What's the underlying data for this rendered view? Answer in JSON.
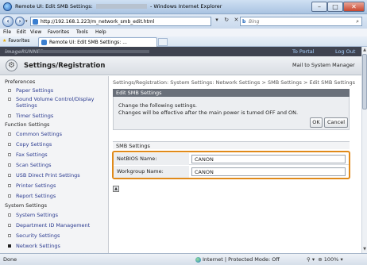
{
  "window": {
    "title_prefix": "Remote UI: Edit SMB Settings:",
    "title_suffix": "- Windows Internet Explorer",
    "buttons": {
      "minimize": "–",
      "maximize": "□",
      "close": "✕"
    }
  },
  "address_bar": {
    "url": "http://192.168.1.223/m_network_smb_edit.html",
    "refresh": "↻",
    "stop": "✕",
    "search_engine": "Bing",
    "search_icon": "search-icon"
  },
  "menu": [
    "File",
    "Edit",
    "View",
    "Favorites",
    "Tools",
    "Help"
  ],
  "favorites_bar": {
    "favorites_label": "Favorites",
    "tab_label": "Remote UI: Edit SMB Settings: ..."
  },
  "page": {
    "product_prefix": "imageRUNNER",
    "portal_link": "To Portal",
    "logout_link": "Log Out",
    "header_title": "Settings/Registration",
    "mail_button": "Mail to System Manager",
    "breadcrumb": "Settings/Registration: System Settings: Network Settings > SMB Settings > Edit SMB Settings",
    "panel_title": "Edit SMB Settings",
    "instruction_line1": "Change the following settings.",
    "instruction_line2": "Changes will be effective after the main power is turned OFF and ON.",
    "ok_label": "OK",
    "cancel_label": "Cancel",
    "smb_section_title": "SMB Settings",
    "fields": [
      {
        "label": "NetBIOS Name:",
        "value": "CANON"
      },
      {
        "label": "Workgroup Name:",
        "value": "CANON"
      }
    ],
    "top_icon": "▲"
  },
  "sidebar": {
    "preferences": "Preferences",
    "pref_items": [
      "Paper Settings",
      "Sound Volume Control/Display Settings",
      "Timer Settings"
    ],
    "function_settings": "Function Settings",
    "func_items": [
      "Common Settings",
      "Copy Settings",
      "Fax Settings",
      "Scan Settings",
      "USB Direct Print Settings",
      "Printer Settings",
      "Report Settings"
    ],
    "system_settings": "System Settings",
    "sys_items": [
      "System Settings",
      "Department ID Management",
      "Security Settings",
      "Network Settings"
    ]
  },
  "status_bar": {
    "status": "Done",
    "zone": "Internet | Protected Mode: Off",
    "zoom": "100%"
  }
}
